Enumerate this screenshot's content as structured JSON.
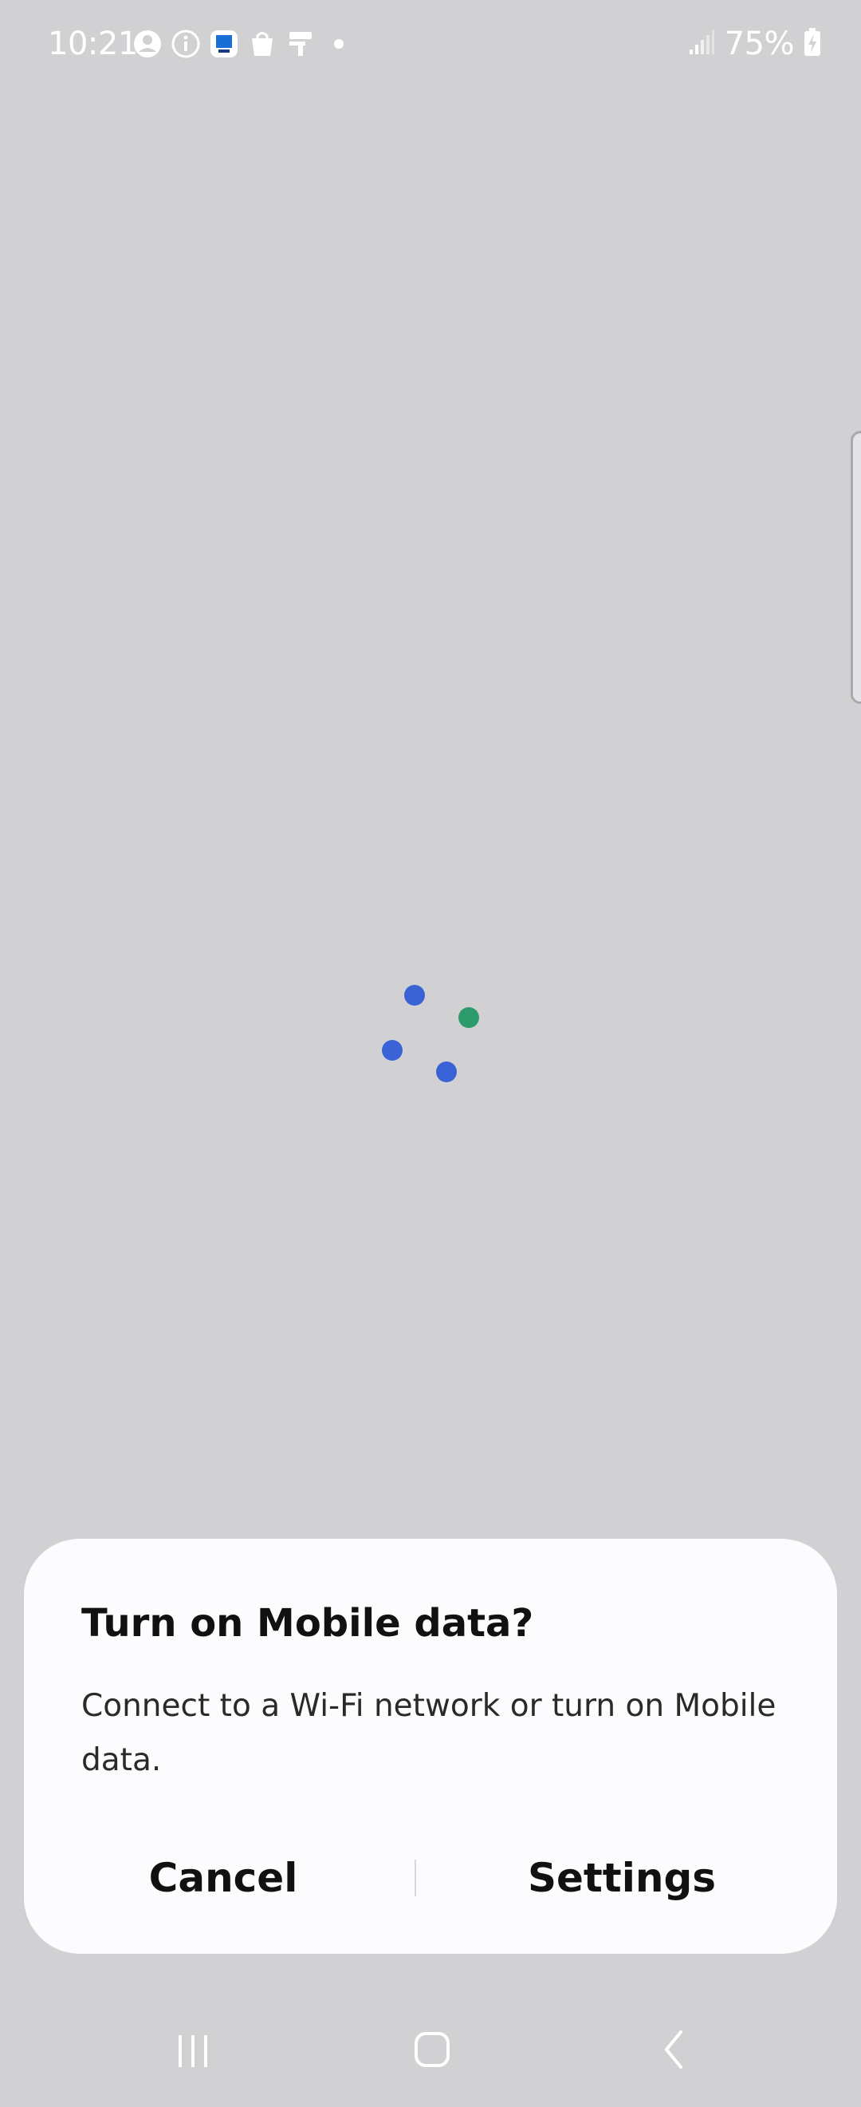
{
  "status_bar": {
    "time": "10:21",
    "battery": "75%",
    "icons": [
      "account-circle-icon",
      "info-icon",
      "app-notification-icon",
      "shopping-bag-icon",
      "paint-roller-icon",
      "dot-icon"
    ]
  },
  "loader": {
    "dot_colors": [
      "#3a63d6",
      "#2c9a6a",
      "#3a63d6",
      "#3a63d6"
    ]
  },
  "dialog": {
    "title": "Turn on Mobile data?",
    "message": "Connect to a Wi-Fi network or turn on Mobile data.",
    "cancel_label": "Cancel",
    "settings_label": "Settings"
  },
  "nav": {
    "buttons": [
      "recent-apps-icon",
      "home-icon",
      "back-icon"
    ]
  }
}
